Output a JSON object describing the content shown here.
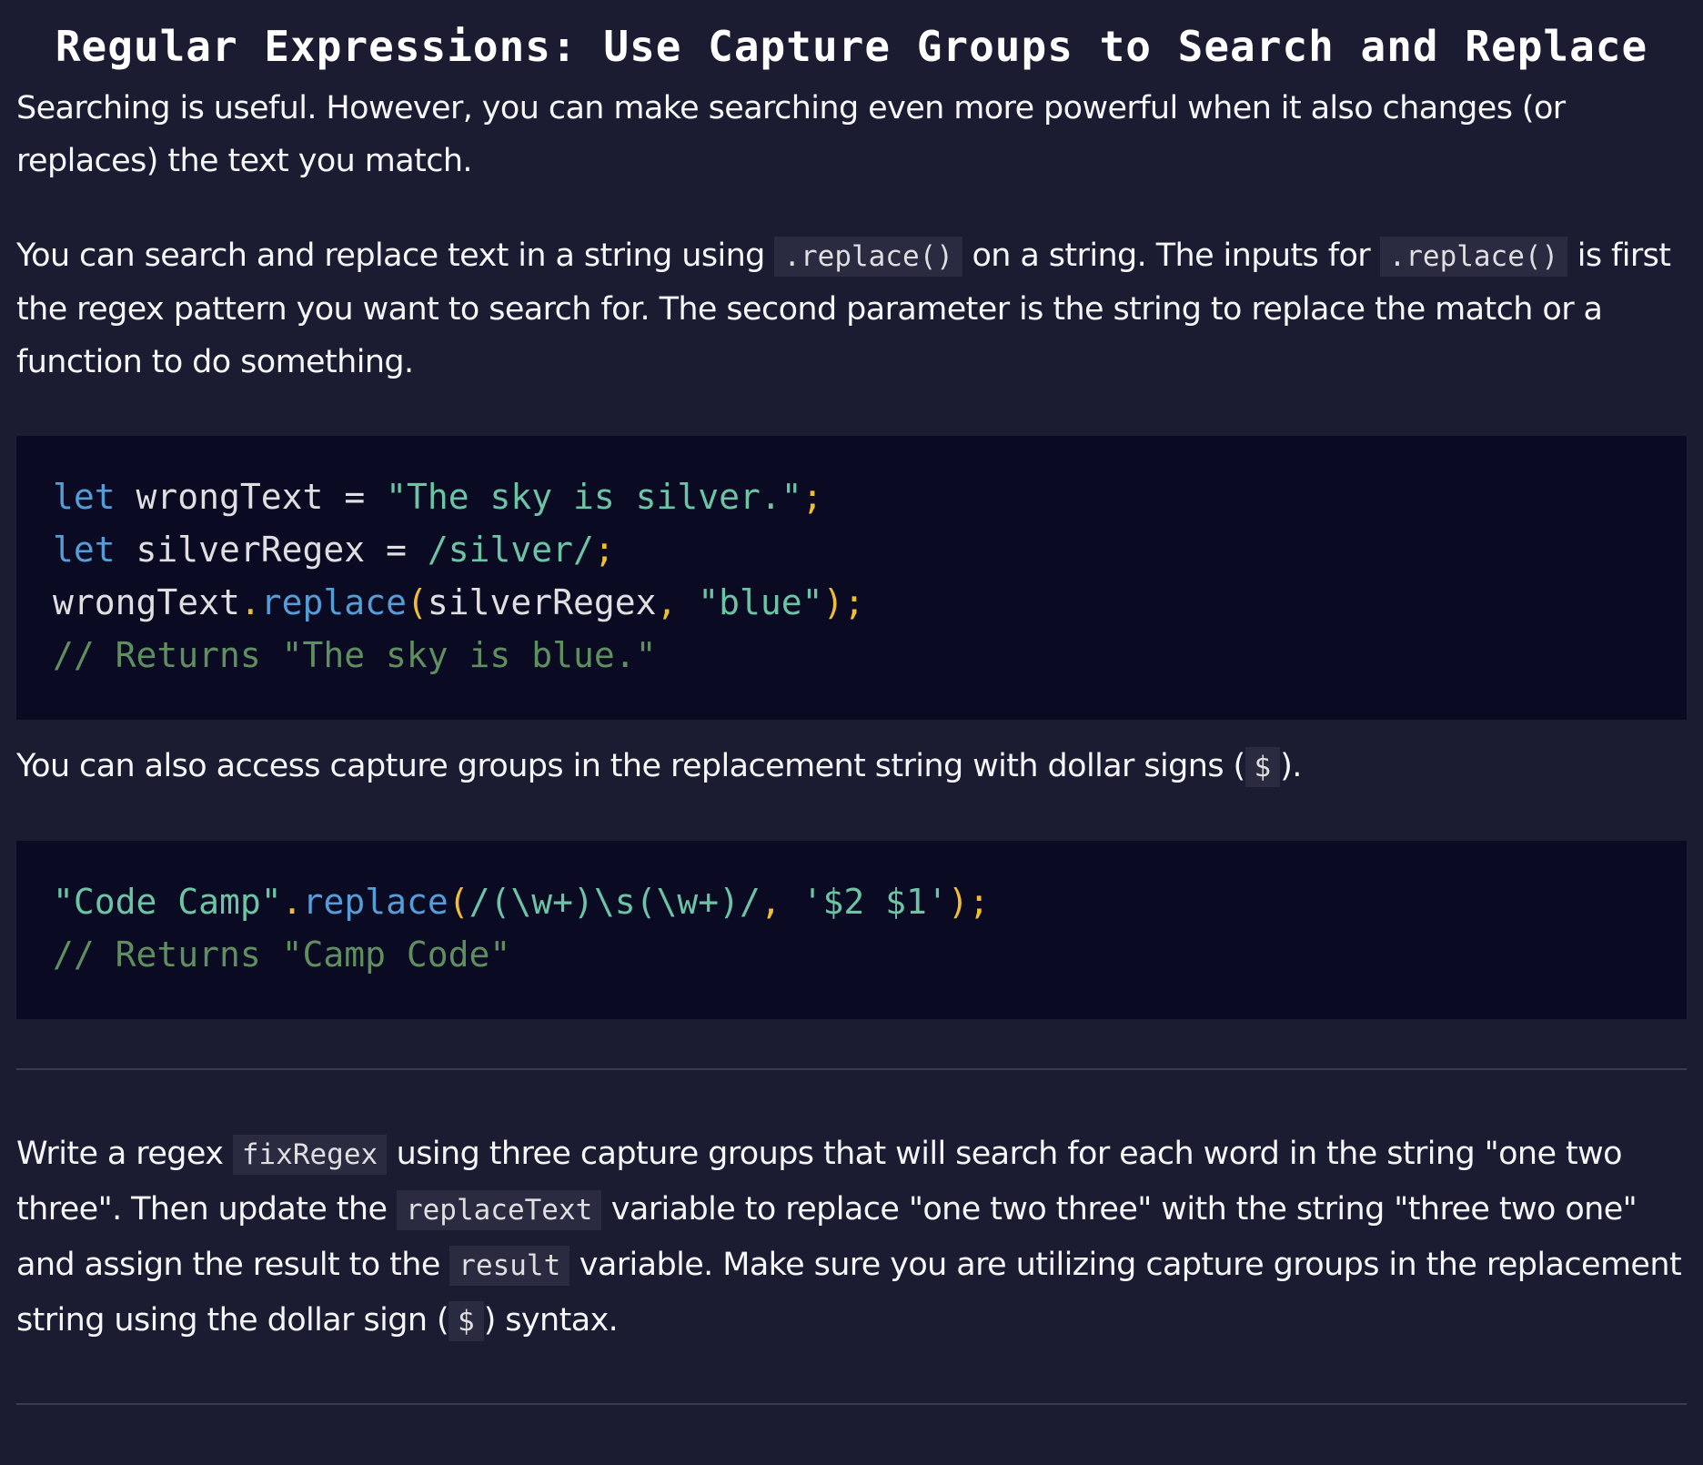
{
  "title": "Regular Expressions: Use Capture Groups to Search and Replace",
  "paragraph1": "Searching is useful. However, you can make searching even more powerful when it also changes (or replaces) the text you match.",
  "paragraph2": {
    "t1": "You can search and replace text in a string using ",
    "code1": ".replace()",
    "t2": " on a string. The inputs for ",
    "code2": ".replace()",
    "t3": " is first the regex pattern you want to search for. The second parameter is the string to replace the match or a function to do something."
  },
  "code_block1": {
    "line1": {
      "kw": "let",
      "var": " wrongText ",
      "op": "=",
      "str": " \"The sky is silver.\"",
      "semi": ";"
    },
    "line2": {
      "kw": "let",
      "var": " silverRegex ",
      "op": "=",
      "re": " /silver/",
      "semi": ";"
    },
    "line3": {
      "obj": "wrongText",
      "dot": ".",
      "fn": "replace",
      "open": "(",
      "arg1": "silverRegex",
      "comma": ", ",
      "str": "\"blue\"",
      "close": ")",
      "semi": ";"
    },
    "line4": "// Returns \"The sky is blue.\""
  },
  "paragraph3": {
    "t1": "You can also access capture groups in the replacement string with dollar signs (",
    "code": "$",
    "t2": ")."
  },
  "code_block2": {
    "line1": {
      "str": "\"Code Camp\"",
      "dot": ".",
      "fn": "replace",
      "open": "(",
      "re": "/(\\w+)\\s(\\w+)/",
      "comma": ", ",
      "arg": "'$2 $1'",
      "close": ")",
      "semi": ";"
    },
    "line2": "// Returns \"Camp Code\""
  },
  "paragraph4": {
    "t1": "Write a regex ",
    "code1": "fixRegex",
    "t2": " using three capture groups that will search for each word in the string \"one two three\". Then update the ",
    "code2": "replaceText",
    "t3": " variable to replace \"one two three\" with the string \"three two one\" and assign the result to the ",
    "code3": "result",
    "t4": " variable. Make sure you are utilizing capture groups in the replacement string using the dollar sign (",
    "code4": "$",
    "t5": ") syntax."
  }
}
